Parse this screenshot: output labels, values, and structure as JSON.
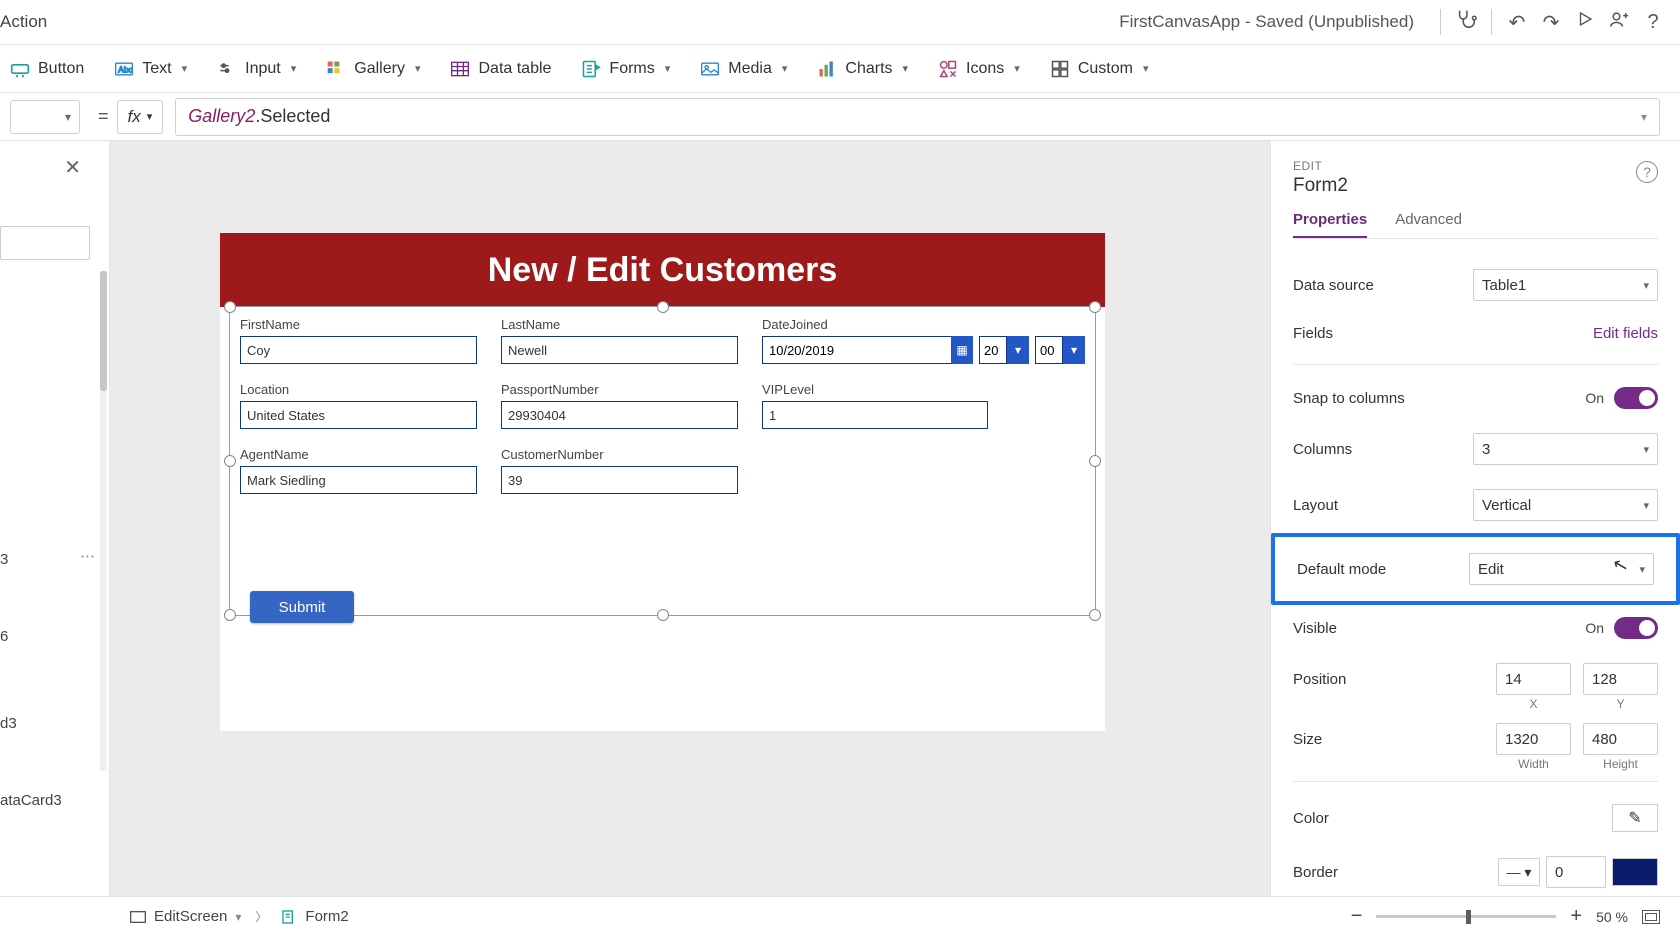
{
  "titlebar": {
    "active_tab": "Action",
    "app_status": "FirstCanvasApp - Saved (Unpublished)"
  },
  "ribbon": {
    "button": "Button",
    "text": "Text",
    "input": "Input",
    "gallery": "Gallery",
    "data_table": "Data table",
    "forms": "Forms",
    "media": "Media",
    "charts": "Charts",
    "icons": "Icons",
    "custom": "Custom"
  },
  "formula_bar": {
    "fx_label": "fx",
    "token1": "Gallery2",
    "token2": ".Selected"
  },
  "tree": {
    "item1": "3",
    "item2": "6",
    "item3": "d3",
    "item4": "ataCard3"
  },
  "canvas": {
    "header": "New / Edit Customers",
    "fields": {
      "firstname_label": "FirstName",
      "firstname_value": "Coy",
      "lastname_label": "LastName",
      "lastname_value": "Newell",
      "datejoined_label": "DateJoined",
      "datejoined_value": "10/20/2019",
      "hour_value": "20",
      "minute_value": "00",
      "location_label": "Location",
      "location_value": "United States",
      "passport_label": "PassportNumber",
      "passport_value": "29930404",
      "viplevel_label": "VIPLevel",
      "viplevel_value": "1",
      "agent_label": "AgentName",
      "agent_value": "Mark Siedling",
      "custnum_label": "CustomerNumber",
      "custnum_value": "39"
    },
    "submit_label": "Submit"
  },
  "properties": {
    "section": "EDIT",
    "object": "Form2",
    "tab_properties": "Properties",
    "tab_advanced": "Advanced",
    "data_source_label": "Data source",
    "data_source_value": "Table1",
    "fields_label": "Fields",
    "edit_fields": "Edit fields",
    "snap_label": "Snap to columns",
    "snap_value": "On",
    "columns_label": "Columns",
    "columns_value": "3",
    "layout_label": "Layout",
    "layout_value": "Vertical",
    "default_mode_label": "Default mode",
    "default_mode_value": "Edit",
    "visible_label": "Visible",
    "visible_value": "On",
    "position_label": "Position",
    "position_x": "14",
    "position_y": "128",
    "x_label": "X",
    "y_label": "Y",
    "size_label": "Size",
    "width_val": "1320",
    "height_val": "480",
    "width_label": "Width",
    "height_label": "Height",
    "color_label": "Color",
    "border_label": "Border",
    "border_width": "0"
  },
  "statusbar": {
    "screen": "EditScreen",
    "form": "Form2",
    "zoom_pct": "50  %"
  }
}
